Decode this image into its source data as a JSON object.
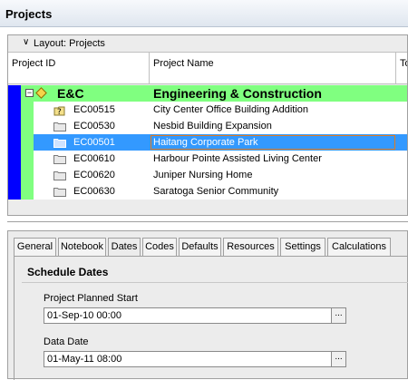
{
  "window": {
    "title": "Projects"
  },
  "layout": {
    "label": "Layout: Projects"
  },
  "columns": {
    "project_id": "Project ID",
    "project_name": "Project Name",
    "truncated": "To"
  },
  "group": {
    "id": "E&C",
    "name": "Engineering & Construction"
  },
  "projects": [
    {
      "id": "EC00515",
      "name": "City Center Office Building Addition",
      "icon": "project-checkout-icon"
    },
    {
      "id": "EC00530",
      "name": "Nesbid Building Expansion",
      "icon": "folder-icon"
    },
    {
      "id": "EC00501",
      "name": "Haitang Corporate Park",
      "icon": "folder-icon",
      "selected": true
    },
    {
      "id": "EC00610",
      "name": "Harbour Pointe Assisted Living Center",
      "icon": "folder-icon"
    },
    {
      "id": "EC00620",
      "name": "Juniper Nursing Home",
      "icon": "folder-icon"
    },
    {
      "id": "EC00630",
      "name": "Saratoga Senior Community",
      "icon": "folder-icon"
    }
  ],
  "tabs": [
    "General",
    "Notebook",
    "Dates",
    "Codes",
    "Defaults",
    "Resources",
    "Settings",
    "Calculations"
  ],
  "active_tab": "Dates",
  "section": {
    "title": "Schedule Dates"
  },
  "fields": {
    "planned_start": {
      "label": "Project Planned Start",
      "value": "01-Sep-10 00:00"
    },
    "data_date": {
      "label": "Data Date",
      "value": "01-May-11 08:00"
    },
    "ellipsis": "..."
  },
  "colors": {
    "group_band": "#80ff80",
    "wbs_band": "#0000ff",
    "selection": "#3399ff",
    "focus_border": "#e07a20"
  }
}
